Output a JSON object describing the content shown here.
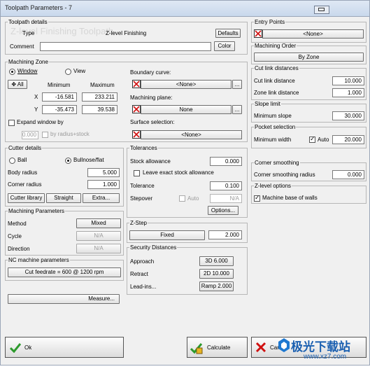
{
  "window": {
    "title": "Toolpath Parameters - 7"
  },
  "toolpath_details": {
    "legend": "Toolpath details",
    "type_label": "Type",
    "type_value": "Z-level Finishing",
    "watermark_text": "Z-level Finishing Toolpath",
    "defaults_label": "Defaults",
    "comment_label": "Comment",
    "comment_value": "",
    "color_label": "Color"
  },
  "entry_points": {
    "legend": "Entry Points",
    "value": "<None>"
  },
  "machining_order": {
    "legend": "Machining Order",
    "button": "By Zone"
  },
  "machining_zone": {
    "legend": "Machining Zone",
    "window_label": "Window",
    "view_label": "View",
    "all_label": "All",
    "minimum_label": "Minimum",
    "maximum_label": "Maximum",
    "x_label": "X",
    "y_label": "Y",
    "x_min": "-16.581",
    "x_max": "233.211",
    "y_min": "-35.473",
    "y_max": "39.538",
    "expand_label": "Expand window by",
    "expand_value": "0.000",
    "by_radius_label": "by radius+stock",
    "boundary_label": "Boundary curve:",
    "boundary_value": "<None>",
    "plane_label": "Machining plane:",
    "plane_value": "None",
    "surface_label": "Surface selection:",
    "surface_value": "<None>"
  },
  "cut_link": {
    "legend": "Cut link distances",
    "cut_label": "Cut link distance",
    "cut_value": "10.000",
    "zone_label": "Zone link distance",
    "zone_value": "1.000"
  },
  "slope_limit": {
    "legend": "Slope limit",
    "label": "Minimum slope",
    "value": "30.000"
  },
  "pocket": {
    "legend": "Pocket selection",
    "label": "Minimum width",
    "auto_label": "Auto",
    "value": "20.000"
  },
  "corner_smoothing": {
    "legend": "Corner smoothing",
    "label": "Corner smoothing radius",
    "value": "0.000"
  },
  "zlevel_options": {
    "legend": "Z-level options",
    "label": "Machine base of walls"
  },
  "cutter": {
    "legend": "Cutter details",
    "ball_label": "Ball",
    "bullnose_label": "Bullnose/flat",
    "body_radius_label": "Body radius",
    "body_radius_value": "5.000",
    "corner_radius_label": "Corner radius",
    "corner_radius_value": "1.000",
    "library_label": "Cutter library",
    "straight_label": "Straight",
    "extra_label": "Extra..."
  },
  "tolerances": {
    "legend": "Tolerances",
    "stock_label": "Stock allowance",
    "stock_value": "0.000",
    "leave_label": "Leave exact stock allowance",
    "tolerance_label": "Tolerance",
    "tolerance_value": "0.100",
    "stepover_label": "Stepover",
    "auto_label": "Auto",
    "stepover_value": "N/A",
    "options_label": "Options..."
  },
  "machining_params": {
    "legend": "Machining Parameters",
    "method_label": "Method",
    "method_value": "Mixed",
    "cycle_label": "Cycle",
    "cycle_value": "N/A",
    "direction_label": "Direction",
    "direction_value": "N/A"
  },
  "zstep": {
    "legend": "Z-Step",
    "mode": "Fixed",
    "value": "2.000"
  },
  "nc": {
    "legend": "NC machine parameters",
    "feedrate": "Cut feedrate = 600 @ 1200 rpm"
  },
  "security": {
    "legend": "Security Distances",
    "approach_label": "Approach",
    "approach_value": "3D 6.000",
    "retract_label": "Retract",
    "retract_value": "2D 10.000",
    "leadins_label": "Lead-ins...",
    "leadins_value": "Ramp 2.000"
  },
  "measure_label": "Measure...",
  "bottom": {
    "ok": "Ok",
    "calculate": "Calculate",
    "cancel": "Cancel"
  },
  "watermark": {
    "text": "极光下载站",
    "url": "www.xz7.com"
  },
  "colors": {
    "title_bg": "#c9d8ec",
    "dialog_bg": "#f0f0f0",
    "x_red": "#d01010"
  }
}
